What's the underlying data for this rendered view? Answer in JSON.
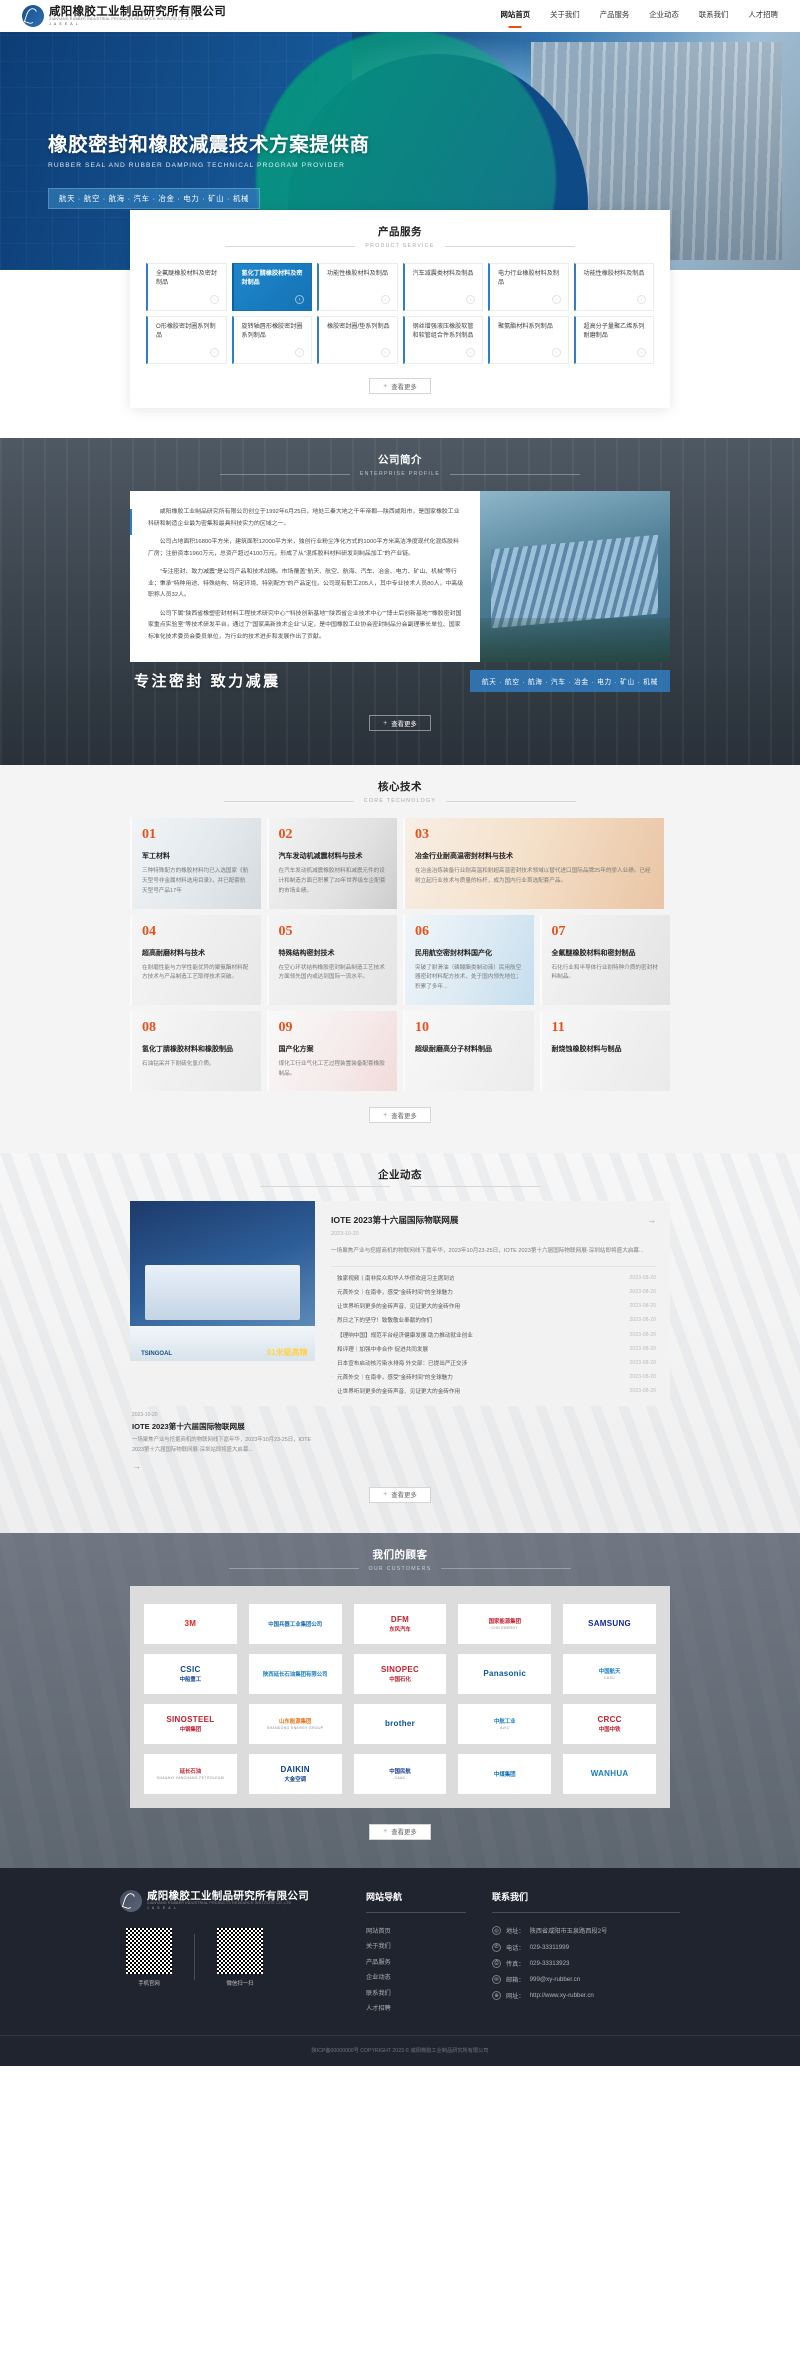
{
  "header": {
    "logo_cn": "咸阳橡胶工业制品研究所有限公司",
    "logo_en": "XIANYANG RUBBER INDUSTRIAL PRODUCTS RESEARCH INSTITUTE CO.,LTD",
    "logo_sub": "J A S E A L",
    "nav": [
      {
        "label": "网站首页",
        "active": true
      },
      {
        "label": "关于我们",
        "active": false
      },
      {
        "label": "产品服务",
        "active": false
      },
      {
        "label": "企业动态",
        "active": false
      },
      {
        "label": "联系我们",
        "active": false
      },
      {
        "label": "人才招聘",
        "active": false
      }
    ]
  },
  "hero": {
    "title": "橡胶密封和橡胶减震技术方案提供商",
    "subtitle": "RUBBER SEAL AND RUBBER DAMPING TECHNICAL PROGRAM PROVIDER",
    "tags": "航天 · 航空 · 航海 · 汽车 · 冶金 · 电力 · 矿山 · 机械"
  },
  "product": {
    "title": "产品服务",
    "title_en": "PRODUCT SERVICE",
    "items": [
      {
        "label": "全氟醚橡胶材料及密封制品",
        "active": false
      },
      {
        "label": "氢化丁腈橡胶材料及密封制品",
        "active": true
      },
      {
        "label": "功能性橡胶材料及制品",
        "active": false
      },
      {
        "label": "汽车减震类材料及制品",
        "active": false
      },
      {
        "label": "电力行业橡胶材料及制品",
        "active": false
      },
      {
        "label": "功能性橡胶材料及制品",
        "active": false
      },
      {
        "label": "O形橡胶密封圈系列制品",
        "active": false
      },
      {
        "label": "旋转轴唇形橡胶密封圈系列制品",
        "active": false
      },
      {
        "label": "橡胶密封圈/垫系列制品",
        "active": false
      },
      {
        "label": "钢丝增强液压橡胶软管和软管组合件系列制品",
        "active": false
      },
      {
        "label": "聚氨酯材料系列制品",
        "active": false
      },
      {
        "label": "超高分子量聚乙烯系列耐磨制品",
        "active": false
      }
    ],
    "more_label": "查看更多"
  },
  "profile": {
    "title": "公司简介",
    "title_en": "ENTERPRISE PROFILE",
    "paragraphs": [
      "咸阳橡胶工业制品研究所有限公司创立于1992年6月25日，地处三秦大地之千年帝都—陕西咸阳市，是国家橡胶工业科研和制造企业最为密集和最具科技实力的区域之一。",
      "公司占地面积16800平方米，建筑面积12000平方米，独创行业粉尘净化方式的1000平方米高洁净度现代化混炼胶料厂房；注册资本1960万元，总资产超过4100万元，形成了从\"混炼胶料材料研发到制品加工\"的产业链。",
      "\"专注密封、致力减震\"是公司产品和技术战略。市场覆盖\"航天、航空、航海、汽车、冶金、电力、矿山、机械\"等行业；秉承\"特种用途、特殊结构、特定环境、特别配方\"的产品定位。公司现有职工205人，其中专业技术人员80人，中高级职称人员32人。",
      "公司下属\"陕西省橡塑密封材料工程技术研究中心\"\"科技创新基地\"\"陕西省企业技术中心\"\"博士后创新基地\"\"橡胶密封国家重点实验室\"等技术研发平台，通过了\"国家高新技术企业\"认定，是中国橡胶工业协会密封制品分会副理事长单位、国家标准化技术委员会委员单位，为行业的技术进步和发展作出了贡献。"
    ],
    "slogan": "专注密封 致力减震",
    "fields": "航天 · 航空 · 航海 · 汽车 · 冶金 · 电力 · 矿山 · 机械",
    "more_label": "查看更多"
  },
  "tech": {
    "title": "核心技术",
    "title_en": "CORE TECHNOLOGY",
    "more_label": "查看更多",
    "cards": [
      {
        "num": "01",
        "name": "军工材料",
        "desc": "三种特殊配方的橡胶材料均已入选国家《航天型号非金属材料选用目录》，并已配套航天型号产品17年",
        "bg": "bg-jet",
        "w": "t-w1"
      },
      {
        "num": "02",
        "name": "汽车发动机减震材料与技术",
        "desc": "在汽车发动机减震橡胶材料和减震元件的设计和制造方面已积累了20年世界级车企配套的市场业绩。",
        "bg": "bg-engine",
        "w": "t-w1"
      },
      {
        "num": "03",
        "name": "冶金行业耐高温密封材料与技术",
        "desc": "在冶金冶炼装备行业耐高温和耐超高温密封技术领域以替代进口国际品牌25年的骄人业绩。已经树立起行业技术与质量的标杆，成为国内行业首选配套产品。",
        "bg": "bg-metal",
        "w": "t-w2"
      },
      {
        "num": "04",
        "name": "超高耐磨材料与技术",
        "desc": "在耐磨性能与力学性能优异的聚氨酯材料配方技术与产品制造工艺取得技术突破。",
        "bg": "bg-ring",
        "w": "t-w1"
      },
      {
        "num": "05",
        "name": "特殊结构密封技术",
        "desc": "在空心环状结构橡胶密封制品制造工艺技术方面领先国内或达到国际一流水平。",
        "bg": "bg-coil",
        "w": "t-w1"
      },
      {
        "num": "06",
        "name": "民用航空密封材料国产化",
        "desc": "突破了耐滑油（磷酸酯类制动液）民用航空器密封材料配方技术，处于国内领先地位；积累了多年...",
        "bg": "bg-plane",
        "w": "t-w1"
      },
      {
        "num": "07",
        "name": "全氟醚橡胶材料和密封制品",
        "desc": "石化行业和半导体行业耐特种介质的密封材料制品。",
        "bg": "bg-hose",
        "w": "t-w1"
      },
      {
        "num": "08",
        "name": "氢化丁腈橡胶材料和橡胶制品",
        "desc": "石油钻采井下耐硫化氢介质。",
        "bg": "bg-spring",
        "w": "t-w1"
      },
      {
        "num": "09",
        "name": "国产化方案",
        "desc": "煤化工行业气化工艺过程装置装备配套橡胶制品。",
        "bg": "bg-flag",
        "w": "t-w1"
      },
      {
        "num": "10",
        "name": "超级耐磨高分子材料制品",
        "desc": "",
        "bg": "bg-fan",
        "w": "t-w1"
      },
      {
        "num": "11",
        "name": "耐烧蚀橡胶材料与制品",
        "desc": "",
        "bg": "bg-roll",
        "w": "t-w1"
      }
    ]
  },
  "news": {
    "title": "企业动态",
    "title_en": "",
    "more_label": "查看更多",
    "featured": {
      "title": "IOTE 2023第十六届国际物联网展",
      "date": "2023-10-20",
      "desc": "一场聚焦产业与挖掘商机的物联网线下嘉年华，2023年10月23-25日，IOTE 2023第十六届国际物联网展·深圳站即将盛大启幕...",
      "arrow": "→",
      "img_brand": "TSINGOAL",
      "img_yellow": "01米级高精"
    },
    "caption": {
      "date": "2023-10-20",
      "title": "IOTE 2023第十六届国际物联网展",
      "desc": "一场聚焦产业与挖掘商机的物联网线下嘉年华，2023年10月23-25日，IOTE 2023第十六届国际物联网展·深圳站即将盛大启幕...",
      "arrow": "→"
    },
    "list": [
      {
        "title": "独家视频丨南非民众和华人华侨欢迎习主席到访",
        "date": "2023-08-20"
      },
      {
        "title": "元首外交｜在南非，感受\"金砖时间\"的全球魅力",
        "date": "2023-08-20"
      },
      {
        "title": "让世界听到更多的金砖声音、见证更大的金砖作用",
        "date": "2023-08-20"
      },
      {
        "title": "烈日之下的坚守！致敬敬业奉献的你们",
        "date": "2023-08-20"
      },
      {
        "title": "【理响中国】规范平台经济健康发展 助力推动就业创业",
        "date": "2023-08-20"
      },
      {
        "title": "和评理｜加强中非合作 促进共同发展",
        "date": "2023-08-20"
      },
      {
        "title": "日本宣布启动核污染水排海 外交部：已提出严正交涉",
        "date": "2023-08-20"
      },
      {
        "title": "元首外交｜在南非，感受\"金砖时间\"的全球魅力",
        "date": "2023-08-20"
      },
      {
        "title": "让世界听到更多的金砖声音、见证更大的金砖作用",
        "date": "2023-08-20"
      }
    ]
  },
  "customers": {
    "title": "我们的顾客",
    "title_en": "OUR CUSTOMERS",
    "more_label": "查看更多",
    "logos": [
      {
        "mark": "3M",
        "cn": "",
        "en": "",
        "color": "#e2231a"
      },
      {
        "mark": "",
        "cn": "中国兵器工业集团公司",
        "en": "",
        "color": "#1a6fb5"
      },
      {
        "mark": "DFM",
        "cn": "东风汽车",
        "en": "",
        "color": "#c8202e"
      },
      {
        "mark": "",
        "cn": "国家能源集团",
        "en": "CHN ENERGY",
        "color": "#c8202e"
      },
      {
        "mark": "SAMSUNG",
        "cn": "",
        "en": "",
        "color": "#1428a0"
      },
      {
        "mark": "CSIC",
        "cn": "中船重工",
        "en": "",
        "color": "#13489e"
      },
      {
        "mark": "",
        "cn": "陕西延长石油集团有限公司",
        "en": "",
        "color": "#1a7fc1"
      },
      {
        "mark": "SINOPEC",
        "cn": "中国石化",
        "en": "",
        "color": "#c8202e"
      },
      {
        "mark": "Panasonic",
        "cn": "",
        "en": "",
        "color": "#0b57a4"
      },
      {
        "mark": "",
        "cn": "中国航天",
        "en": "CASC",
        "color": "#1a7fc1"
      },
      {
        "mark": "SINOSTEEL",
        "cn": "中钢集团",
        "en": "",
        "color": "#c8202e"
      },
      {
        "mark": "",
        "cn": "山东能源集团",
        "en": "SHANDONG ENERGY GROUP",
        "color": "#e8731a"
      },
      {
        "mark": "brother",
        "cn": "",
        "en": "",
        "color": "#0a4f9e"
      },
      {
        "mark": "",
        "cn": "中航工业",
        "en": "AVIC",
        "color": "#1a7fc1"
      },
      {
        "mark": "CRCC",
        "cn": "中国中铁",
        "en": "",
        "color": "#c8202e"
      },
      {
        "mark": "",
        "cn": "延长石油",
        "en": "SHAANXI YANCHANG PETROLEUM",
        "color": "#c8202e"
      },
      {
        "mark": "DAIKIN",
        "cn": "大金空调",
        "en": "",
        "color": "#0a3f8f"
      },
      {
        "mark": "",
        "cn": "中国民航",
        "en": "CAAC",
        "color": "#1a3f8f"
      },
      {
        "mark": "",
        "cn": "中煤集团",
        "en": "",
        "color": "#0b6fb5"
      },
      {
        "mark": "WANHUA",
        "cn": "",
        "en": "",
        "color": "#1a7fc1"
      }
    ]
  },
  "footer": {
    "logo_cn": "咸阳橡胶工业制品研究所有限公司",
    "logo_en": "XIANYANG RUBBER INDUSTRIAL PRODUCTS RESEARCH INSTITUTE CO.,LTD",
    "logo_sub": "J A S E A L",
    "qr": [
      {
        "caption": "手机官网"
      },
      {
        "caption": "微信扫一扫"
      }
    ],
    "nav_title": "网站导航",
    "nav": [
      "网站首页",
      "关于我们",
      "产品服务",
      "企业动态",
      "联系我们",
      "人才招聘"
    ],
    "contact_title": "联系我们",
    "contacts": [
      {
        "icon": "location-icon",
        "glyph": "◎",
        "label": "地址：",
        "value": "陕西省咸阳市玉泉路西段2号"
      },
      {
        "icon": "phone-icon",
        "glyph": "✆",
        "label": "电话：",
        "value": "029-33311999"
      },
      {
        "icon": "fax-icon",
        "glyph": "⎙",
        "label": "传真：",
        "value": "029-33313923"
      },
      {
        "icon": "mail-icon",
        "glyph": "✉",
        "label": "邮箱：",
        "value": "999@xy-rubber.cn"
      },
      {
        "icon": "globe-icon",
        "glyph": "⊕",
        "label": "网址：",
        "value": "http://www.xy-rubber.cn"
      }
    ],
    "copyright": "陕ICP备00000000号   COPYRIGHT 2023 © 咸阳橡胶工业制品研究所有限公司"
  }
}
